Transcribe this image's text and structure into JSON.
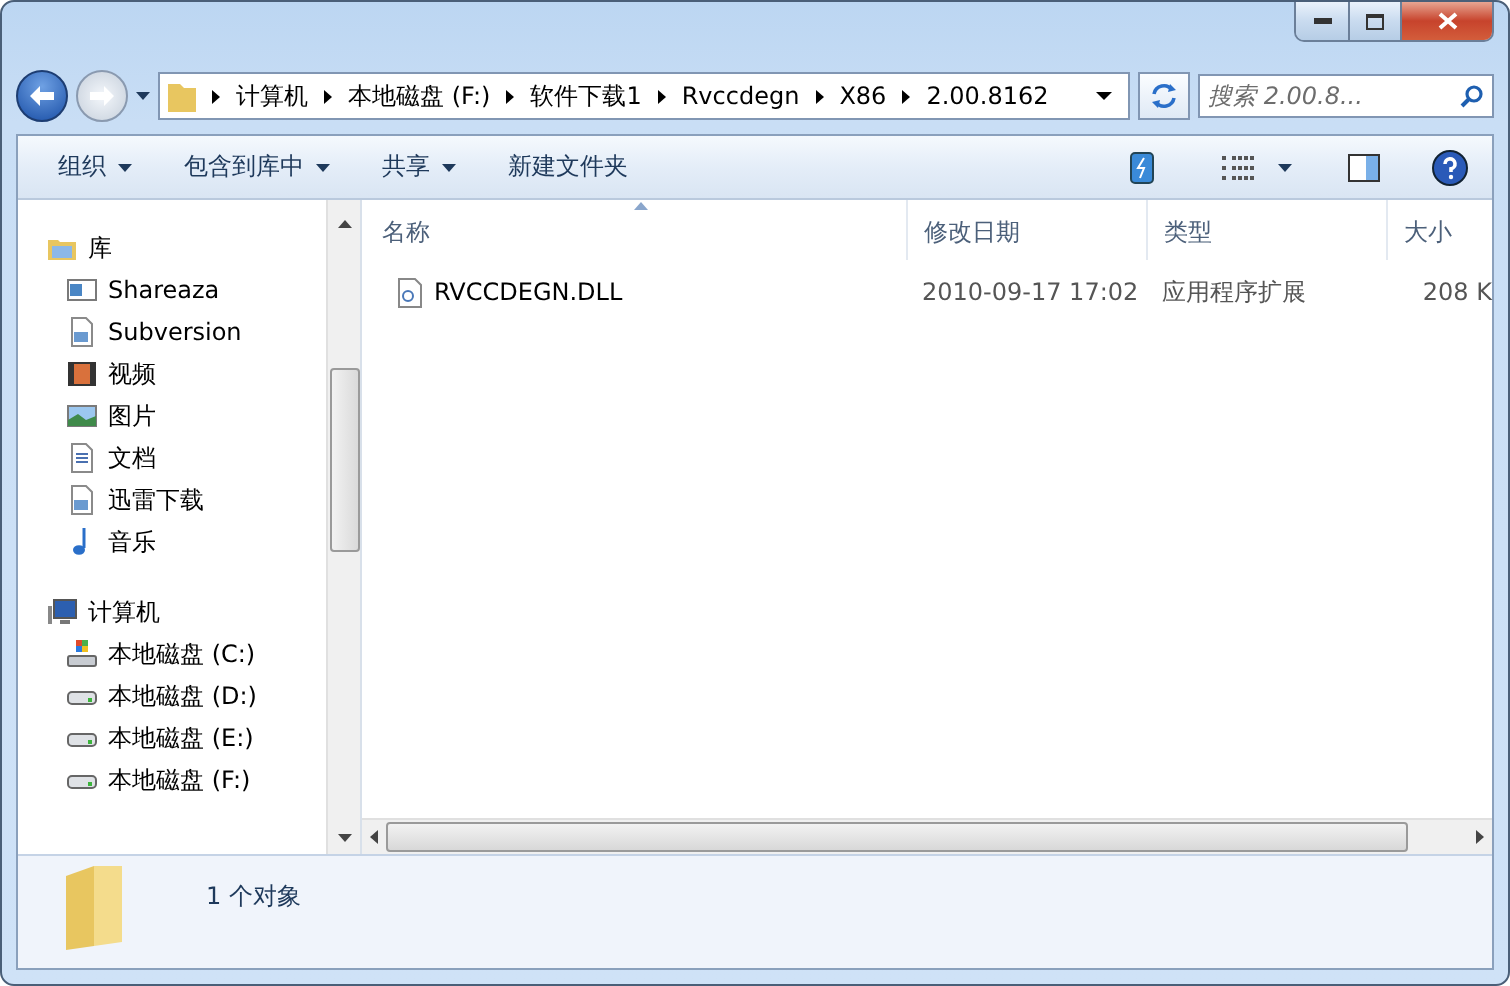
{
  "address_bar": {
    "crumbs": [
      "计算机",
      "本地磁盘 (F:)",
      "软件下载1",
      "Rvccdegn",
      "X86",
      "2.00.8162"
    ]
  },
  "search": {
    "placeholder": "搜索 2.00.8..."
  },
  "toolbar": {
    "buttons": [
      {
        "label": "组织",
        "dropdown": true
      },
      {
        "label": "包含到库中",
        "dropdown": true
      },
      {
        "label": "共享",
        "dropdown": true
      },
      {
        "label": "新建文件夹",
        "dropdown": false
      }
    ]
  },
  "nav": {
    "groups": [
      {
        "label": "库",
        "kind": "library",
        "children": [
          {
            "label": "Shareaza",
            "kind": "app"
          },
          {
            "label": "Subversion",
            "kind": "doc"
          },
          {
            "label": "视频",
            "kind": "video"
          },
          {
            "label": "图片",
            "kind": "picture"
          },
          {
            "label": "文档",
            "kind": "text"
          },
          {
            "label": "迅雷下载",
            "kind": "doc"
          },
          {
            "label": "音乐",
            "kind": "music"
          }
        ]
      },
      {
        "label": "计算机",
        "kind": "computer",
        "children": [
          {
            "label": "本地磁盘 (C:)",
            "kind": "system-drive"
          },
          {
            "label": "本地磁盘 (D:)",
            "kind": "drive"
          },
          {
            "label": "本地磁盘 (E:)",
            "kind": "drive"
          },
          {
            "label": "本地磁盘 (F:)",
            "kind": "drive"
          }
        ]
      }
    ]
  },
  "file_list": {
    "columns": [
      {
        "label": "名称",
        "sorted": true
      },
      {
        "label": "修改日期",
        "sorted": false
      },
      {
        "label": "类型",
        "sorted": false
      },
      {
        "label": "大小",
        "sorted": false
      }
    ],
    "rows": [
      {
        "name": "RVCCDEGN.DLL",
        "date": "2010-09-17 17:02",
        "type": "应用程序扩展",
        "size": "208 K"
      }
    ]
  },
  "status": {
    "text": "1 个对象"
  }
}
